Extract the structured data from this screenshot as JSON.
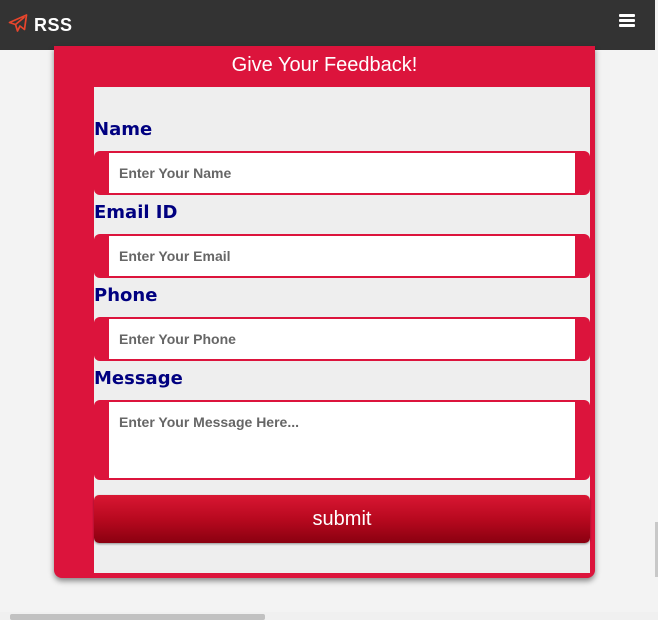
{
  "navbar": {
    "brand": "RSS",
    "brand_icon": "paper-plane-icon",
    "menu_icon": "hamburger-menu-icon",
    "accent_color": "#e8452c",
    "background": "#333333"
  },
  "form": {
    "title": "Give Your Feedback!",
    "name": {
      "label": "Name",
      "placeholder": "Enter Your Name"
    },
    "email": {
      "label": "Email ID",
      "placeholder": "Enter Your Email"
    },
    "phone": {
      "label": "Phone",
      "placeholder": "Enter Your Phone"
    },
    "message": {
      "label": "Message",
      "placeholder": "Enter Your Message Here..."
    },
    "submit_label": "submit",
    "card_color": "#dc143c",
    "label_color": "#000080"
  }
}
